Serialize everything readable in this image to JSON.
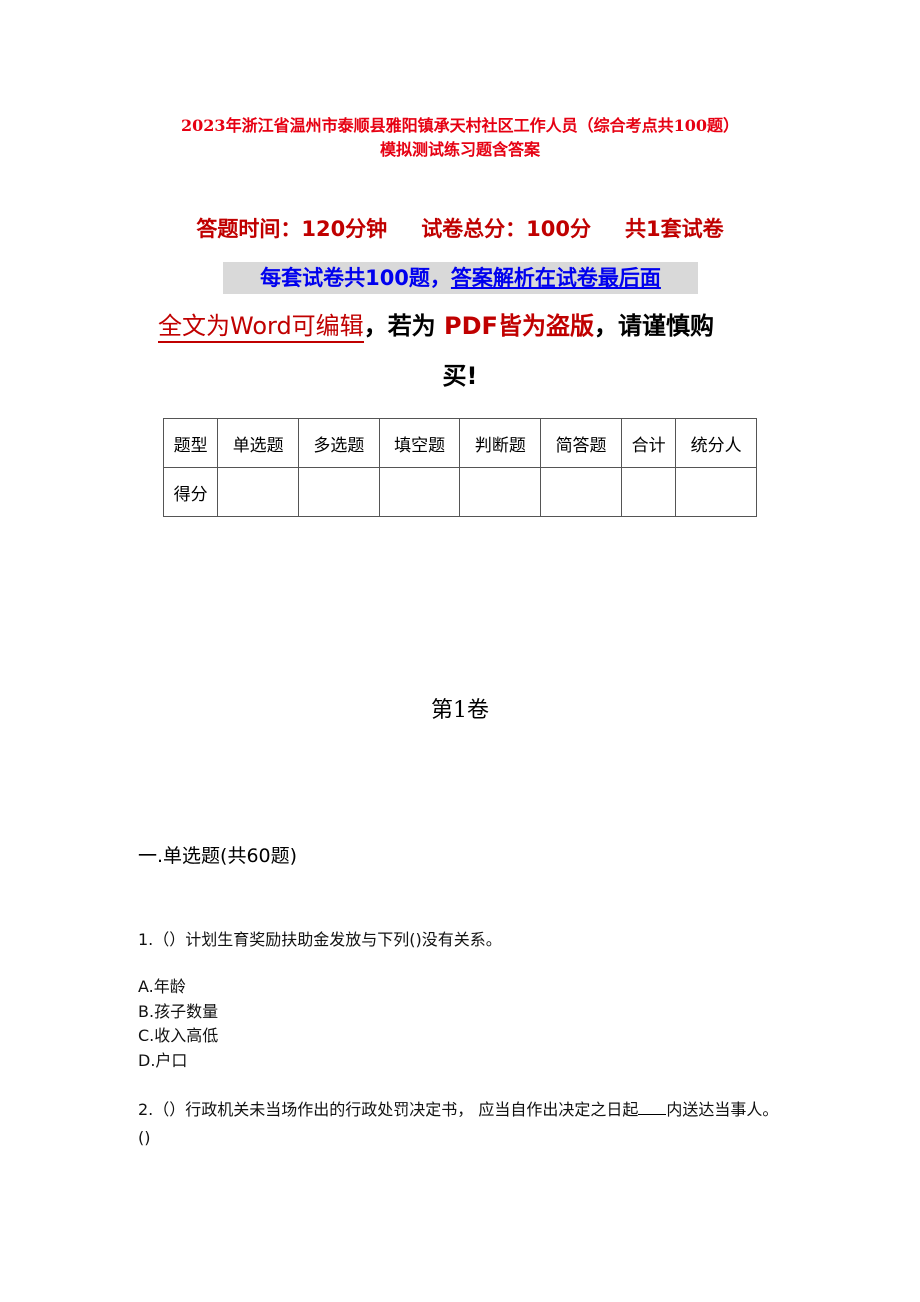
{
  "document": {
    "title_line1": "2023年浙江省温州市泰顺县雅阳镇承天村社区工作人员（综合考点共100题）",
    "title_line2": "模拟测试练习题含答案",
    "info": {
      "time": "答题时间：120分钟",
      "total_score": "试卷总分：100分",
      "sets": "共1套试卷"
    },
    "banner": {
      "part1": "每套试卷共100题，",
      "part2": "答案解析在试卷最后面"
    },
    "notice": {
      "editable": "全文为Word可编辑",
      "comma1": "，",
      "if_pdf": "若为",
      "pdf_piracy": "PDF皆为盗版",
      "comma2": "，",
      "careful": "请谨慎购",
      "line2": "买!"
    },
    "score_table": {
      "header": [
        "题型",
        "单选题",
        "多选题",
        "填空题",
        "判断题",
        "简答题",
        "合计",
        "统分人"
      ],
      "row": [
        "得分",
        "",
        "",
        "",
        "",
        "",
        "",
        ""
      ]
    },
    "volume_title": "第1卷",
    "section_title": "一.单选题(共60题)",
    "questions": [
      {
        "text": "1.（）计划生育奖励扶助金发放与下列()没有关系。",
        "options": [
          "A.年龄",
          "B.孩子数量",
          "C.收入高低",
          "D.户口"
        ]
      },
      {
        "text_before_blank": "2.（）行政机关未当场作出的行政处罚决定书， 应当自作出决定之日起",
        "text_after_blank": "内送达当事人。 ()"
      }
    ]
  }
}
